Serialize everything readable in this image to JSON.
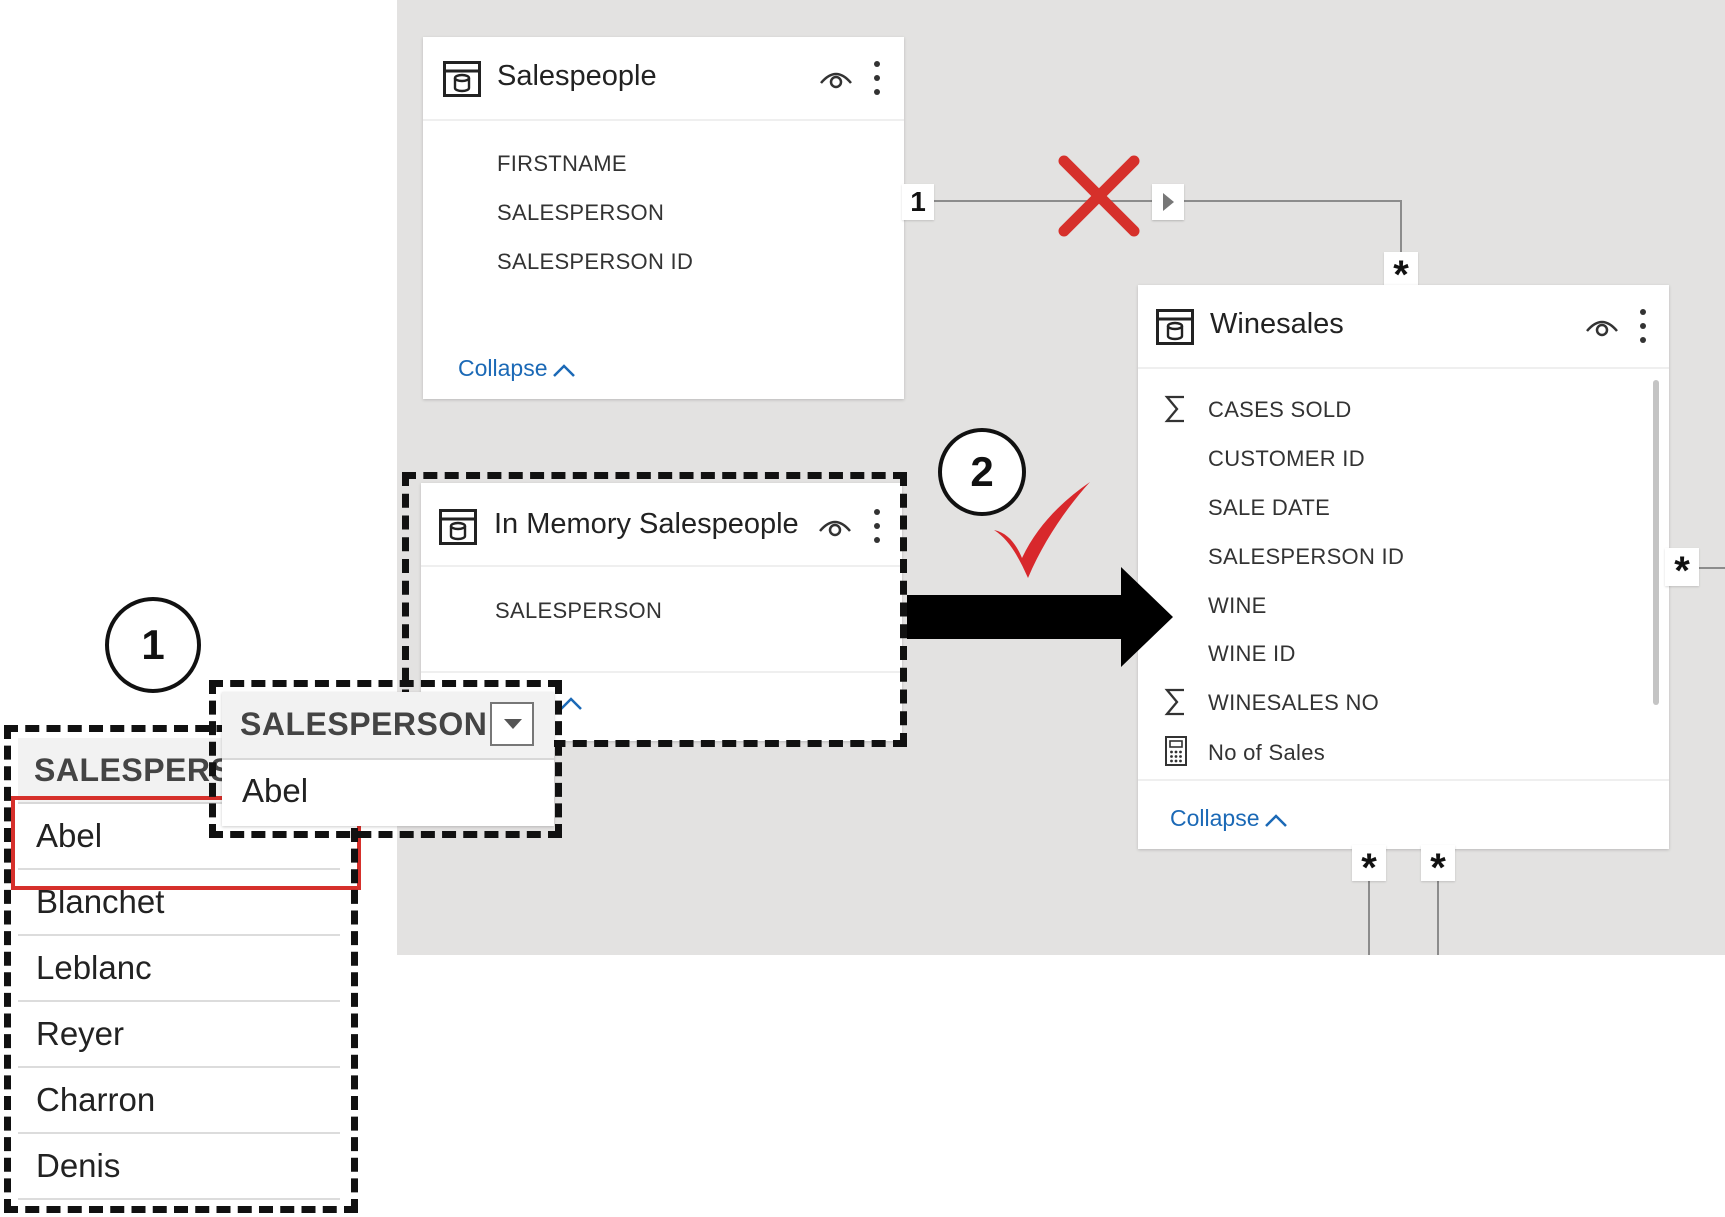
{
  "salespeople_table": {
    "title": "Salespeople",
    "fields": [
      "FIRSTNAME",
      "SALESPERSON",
      "SALESPERSON ID"
    ],
    "collapse_label": "Collapse"
  },
  "in_memory_table": {
    "title": "In Memory Salespeople",
    "fields": [
      "SALESPERSON"
    ]
  },
  "winesales_table": {
    "title": "Winesales",
    "fields": [
      "CASES SOLD",
      "CUSTOMER ID",
      "SALE DATE",
      "SALESPERSON ID",
      "WINE",
      "WINE ID",
      "WINESALES NO",
      "No of Sales"
    ],
    "collapse_label": "Collapse"
  },
  "relationships": {
    "one_label": "1",
    "many_label": "*"
  },
  "callouts": {
    "step1": "1",
    "step2": "2"
  },
  "salesperson_grid": {
    "header": "SALESPERSON",
    "rows": [
      "Abel",
      "Blanchet",
      "Leblanc",
      "Reyer",
      "Charron",
      "Denis"
    ]
  },
  "slicer": {
    "header": "SALESPERSON",
    "selected_value": "Abel"
  },
  "colors": {
    "canvas": "#e3e2e1",
    "accent_link": "#1b69b6",
    "error_red": "#d6302b",
    "check_red": "#d8282c"
  }
}
